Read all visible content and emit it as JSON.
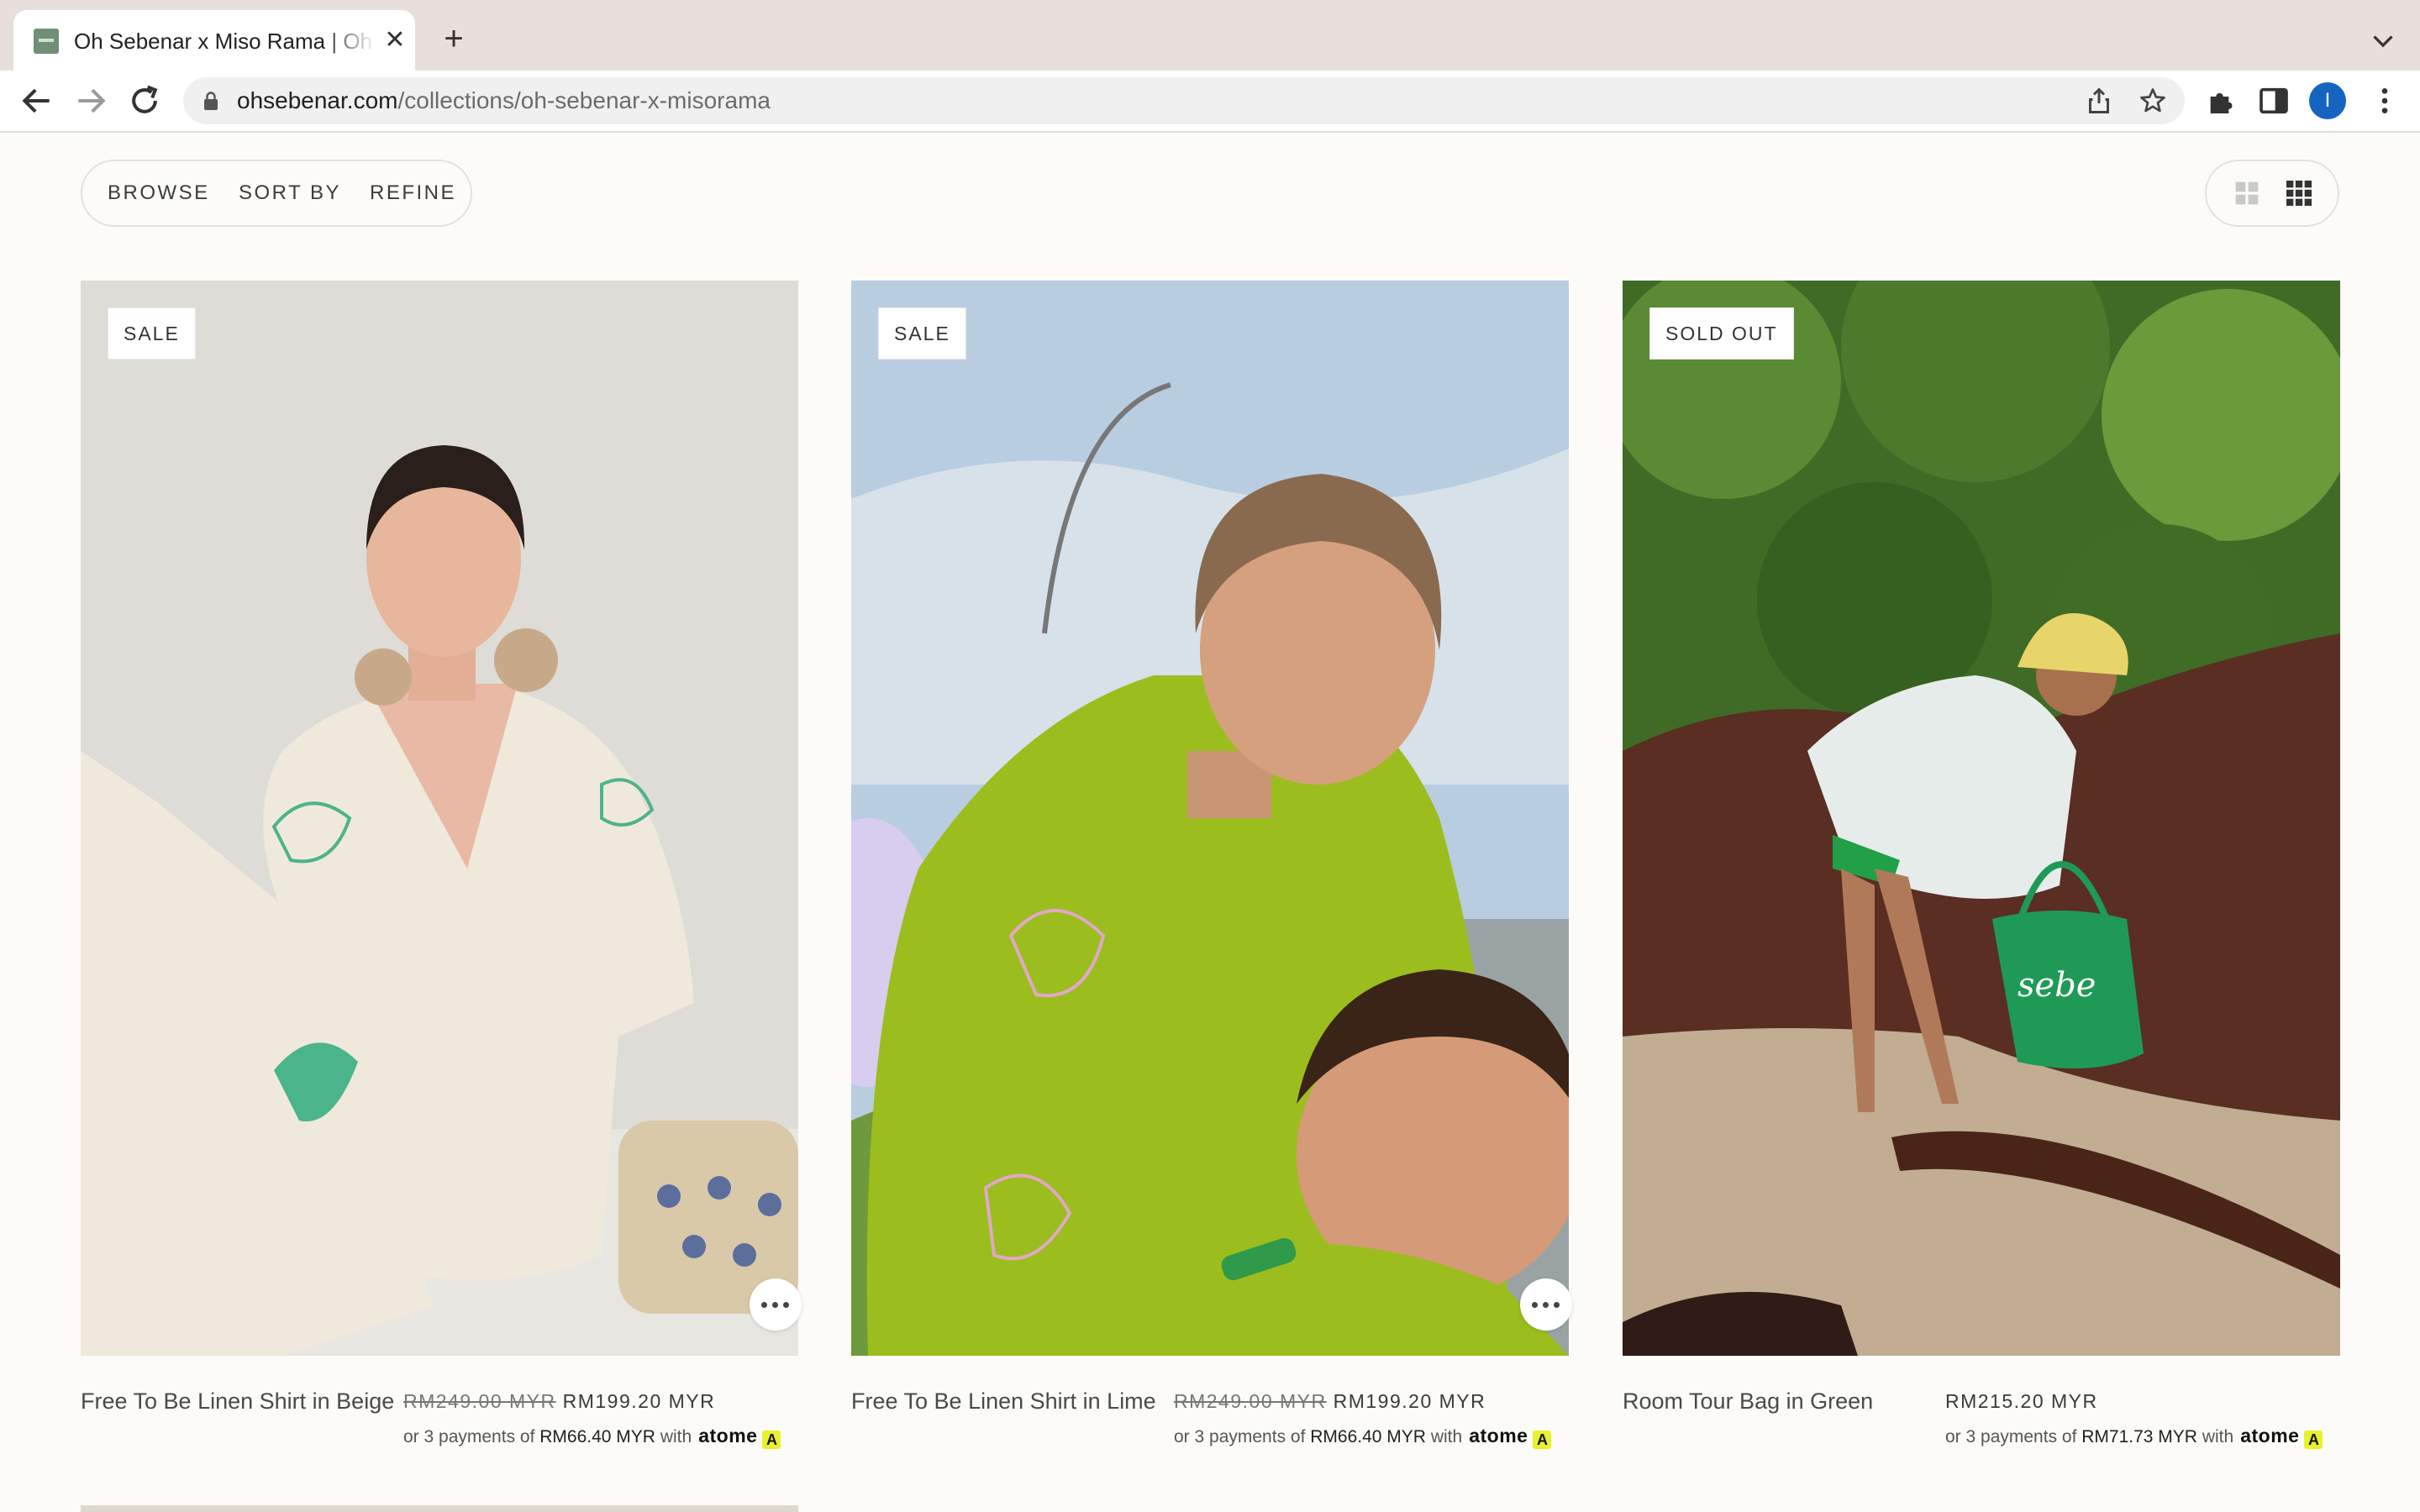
{
  "browser": {
    "tab_title": "Oh Sebenar x Miso Rama | Oh Sebenar",
    "url_host": "ohsebenar.com",
    "url_path": "/collections/oh-sebenar-x-misorama",
    "avatar_letter": "I"
  },
  "filters": {
    "browse": "BROWSE",
    "sort_by": "SORT BY",
    "refine": "REFINE"
  },
  "products": [
    {
      "badge": "SALE",
      "name": "Free To Be Linen Shirt in Beige",
      "old_price": "RM249.00 MYR",
      "price": "RM199.20 MYR",
      "installment_prefix": "or 3 payments of",
      "installment_amount": "RM66.40 MYR",
      "installment_with": "with",
      "installment_brand": "atome",
      "image_colors": {
        "bg": "#dedcd6",
        "garment": "#efe9dc",
        "accent": "#4cb48a"
      }
    },
    {
      "badge": "SALE",
      "name": "Free To Be Linen Shirt in Lime",
      "old_price": "RM249.00 MYR",
      "price": "RM199.20 MYR",
      "installment_prefix": "or 3 payments of",
      "installment_amount": "RM66.40 MYR",
      "installment_with": "with",
      "installment_brand": "atome",
      "image_colors": {
        "bg": "#b9cde0",
        "garment": "#9cbd1e",
        "accent": "#e2a8c8"
      }
    },
    {
      "badge": "SOLD OUT",
      "name": "Room Tour Bag in Green",
      "old_price": "",
      "price": "RM215.20 MYR",
      "installment_prefix": "or 3 payments of",
      "installment_amount": "RM71.73 MYR",
      "installment_with": "with",
      "installment_brand": "atome",
      "bag_print": "sebe",
      "image_colors": {
        "bg": "#3f6b26",
        "rock": "#5a2e22",
        "sand": "#c2ad93",
        "bag": "#1f9a56"
      }
    }
  ]
}
